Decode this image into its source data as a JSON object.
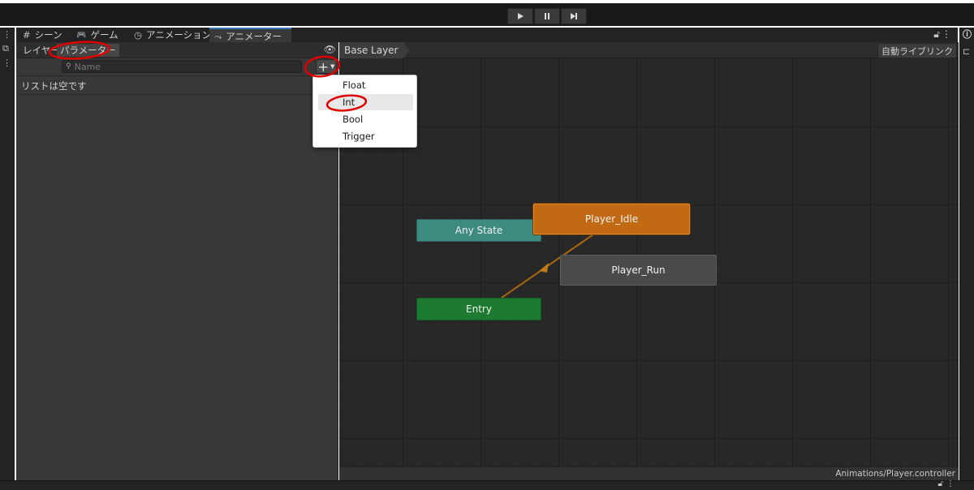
{
  "toolbar": {
    "play_icon": "play-icon",
    "pause_icon": "pause-icon",
    "step_icon": "step-icon"
  },
  "tabs": [
    {
      "icon": "#",
      "label": "シーン"
    },
    {
      "icon": "🎮",
      "label": "ゲーム"
    },
    {
      "icon": "◷",
      "label": "アニメーション"
    },
    {
      "icon": "⤳",
      "label": "アニメーター"
    }
  ],
  "params_panel": {
    "tab_layers": "レイヤー",
    "tab_parameters": "パラメーター",
    "search_placeholder": "Name",
    "add_button": "+",
    "empty_text": "リストは空です"
  },
  "graph": {
    "breadcrumb": "Base Layer",
    "auto_live_link": "自動ライブリンク",
    "status_path": "Animations/Player.controller",
    "nodes": {
      "any_state": "Any State",
      "player_idle": "Player_Idle",
      "player_run": "Player_Run",
      "entry": "Entry"
    }
  },
  "add_menu": {
    "items": [
      "Float",
      "Int",
      "Bool",
      "Trigger"
    ],
    "highlighted": "Int"
  },
  "colors": {
    "accent_tab": "#3a79bb",
    "default_state": "#c16a13",
    "any_state": "#3c8a80",
    "entry": "#1d7a31",
    "annotation": "#e00000"
  }
}
